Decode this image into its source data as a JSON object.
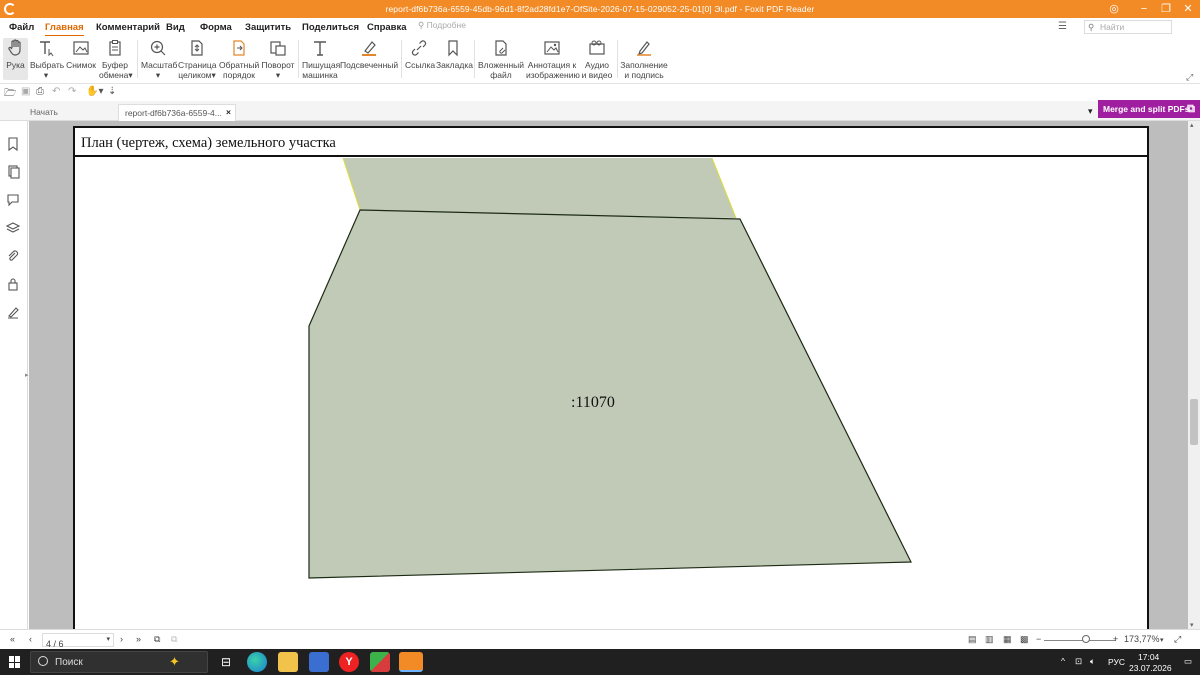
{
  "app": {
    "window_title": "report-df6b736a-6559-45db-96d1-8f2ad28fd1e7-OfSite-2026-07-15-029052-25-01[0] Эl.pdf - Foxit PDF Reader"
  },
  "menu": {
    "items": [
      "Файл",
      "Главная",
      "Комментарий",
      "Вид",
      "Форма",
      "Защитить",
      "Поделиться",
      "Справка"
    ],
    "active": "Главная",
    "search_hint": "Подробне",
    "find_placeholder": "Найти"
  },
  "ribbon": {
    "tools": [
      {
        "label1": "Рука",
        "label2": "",
        "icon": "hand-icon"
      },
      {
        "label1": "Выбрать",
        "label2": "",
        "icon": "select-text-icon"
      },
      {
        "label1": "Снимок",
        "label2": "",
        "icon": "snapshot-icon"
      },
      {
        "label1": "Буфер",
        "label2": "обмена",
        "icon": "clipboard-icon"
      },
      {
        "label1": "Масштаб",
        "label2": "",
        "icon": "zoom-icon"
      },
      {
        "label1": "Страница",
        "label2": "целиком",
        "icon": "fit-page-icon"
      },
      {
        "label1": "Обратный",
        "label2": "порядок",
        "icon": "reverse-order-icon"
      },
      {
        "label1": "Поворот",
        "label2": "",
        "icon": "rotate-icon"
      },
      {
        "label1": "Пишущая",
        "label2": "машинка",
        "icon": "typewriter-icon"
      },
      {
        "label1": "Подсвеченный",
        "label2": "",
        "icon": "highlight-icon"
      },
      {
        "label1": "Ссылка",
        "label2": "",
        "icon": "link-icon"
      },
      {
        "label1": "Закладка",
        "label2": "",
        "icon": "bookmark-icon"
      },
      {
        "label1": "Вложенный",
        "label2": "файл",
        "icon": "attach-file-icon"
      },
      {
        "label1": "Аннотация к",
        "label2": "изображению",
        "icon": "image-annotation-icon"
      },
      {
        "label1": "Аудио",
        "label2": "и видео",
        "icon": "audio-video-icon"
      },
      {
        "label1": "Заполнение",
        "label2": "и подпись",
        "icon": "fill-sign-icon"
      }
    ]
  },
  "tabs": {
    "start": "Начать",
    "document": "report-df6b736a-6559-4...",
    "merge_button": "Merge and split PDFs"
  },
  "document": {
    "section_title": "План (чертеж, схема) земельного участка",
    "parcel_label": ":11070",
    "parcel_fill": "#c0cab7"
  },
  "status": {
    "page_indicator": "4 / 6",
    "zoom": "173,77%"
  },
  "taskbar": {
    "search_label": "Поиск",
    "lang": "РУС",
    "time": "17:04",
    "date": "23.07.2026"
  }
}
